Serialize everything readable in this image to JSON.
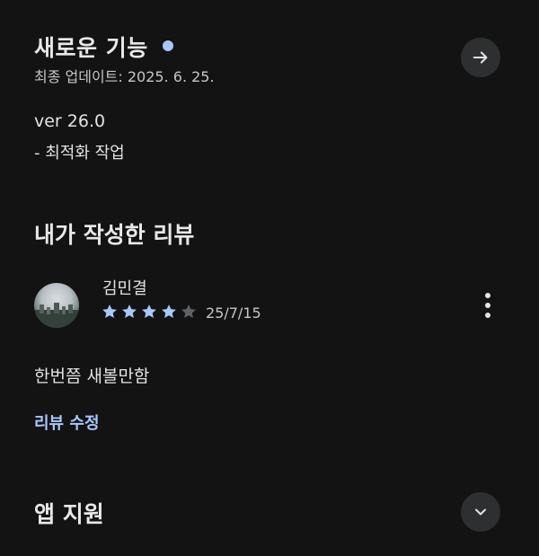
{
  "whats_new": {
    "title": "새로운 기능",
    "updated": "최종 업데이트: 2025. 6. 25.",
    "version": "ver 26.0",
    "notes": "- 최적화 작업",
    "arrow_icon": "arrow-right-icon"
  },
  "reviews": {
    "title": "내가 작성한 리뷰",
    "reviewer_name": "김민결",
    "rating": 4,
    "max_rating": 5,
    "date": "25/7/15",
    "text": "한번쯤 새볼만함",
    "edit_label": "리뷰 수정"
  },
  "app_support": {
    "title": "앱 지원",
    "chevron_icon": "chevron-down-icon"
  },
  "colors": {
    "background": "#131313",
    "accent": "#a8c7fa",
    "star_filled": "#a8c7fa",
    "star_empty": "#5f6368",
    "button_bg": "#2e2f30"
  }
}
